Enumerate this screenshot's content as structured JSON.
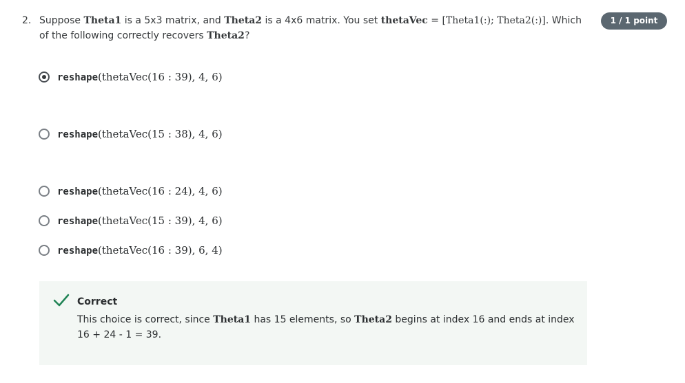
{
  "question": {
    "number": "2.",
    "text_1": "Suppose ",
    "var_theta1": "Theta1",
    "text_2": " is a 5x3 matrix, and ",
    "var_theta2": "Theta2",
    "text_3": " is a 4x6 matrix. You set ",
    "var_thetavec": "thetaVec",
    "math_assign": " = [Theta1(:); Theta2(:)].",
    "text_4": " Which of the following correctly recovers ",
    "var_theta2_end": "Theta2",
    "text_5": "?"
  },
  "points_badge": "1 / 1 point",
  "options": [
    {
      "fn": "reshape",
      "args": "(thetaVec(16 : 39), 4, 6)",
      "selected": true
    },
    {
      "fn": "reshape",
      "args": "(thetaVec(15 : 38), 4, 6)",
      "selected": false
    },
    {
      "fn": "reshape",
      "args": "(thetaVec(16 : 24), 4, 6)",
      "selected": false
    },
    {
      "fn": "reshape",
      "args": "(thetaVec(15 : 39), 4, 6)",
      "selected": false
    },
    {
      "fn": "reshape",
      "args": "(thetaVec(16 : 39), 6, 4)",
      "selected": false
    }
  ],
  "feedback": {
    "title": "Correct",
    "text_1": "This choice is correct, since ",
    "var_theta1": "Theta1",
    "text_2": " has 15 elements, so ",
    "var_theta2": "Theta2",
    "text_3": " begins at index 16 and ends at index 16 + 24 - 1 = 39."
  },
  "colors": {
    "badge_bg": "#5b6770",
    "feedback_bg": "#f3f7f4",
    "check_green": "#1f8354"
  },
  "icons": {
    "check": "check-icon",
    "radio_selected": "radio-selected-icon",
    "radio_empty": "radio-empty-icon"
  }
}
